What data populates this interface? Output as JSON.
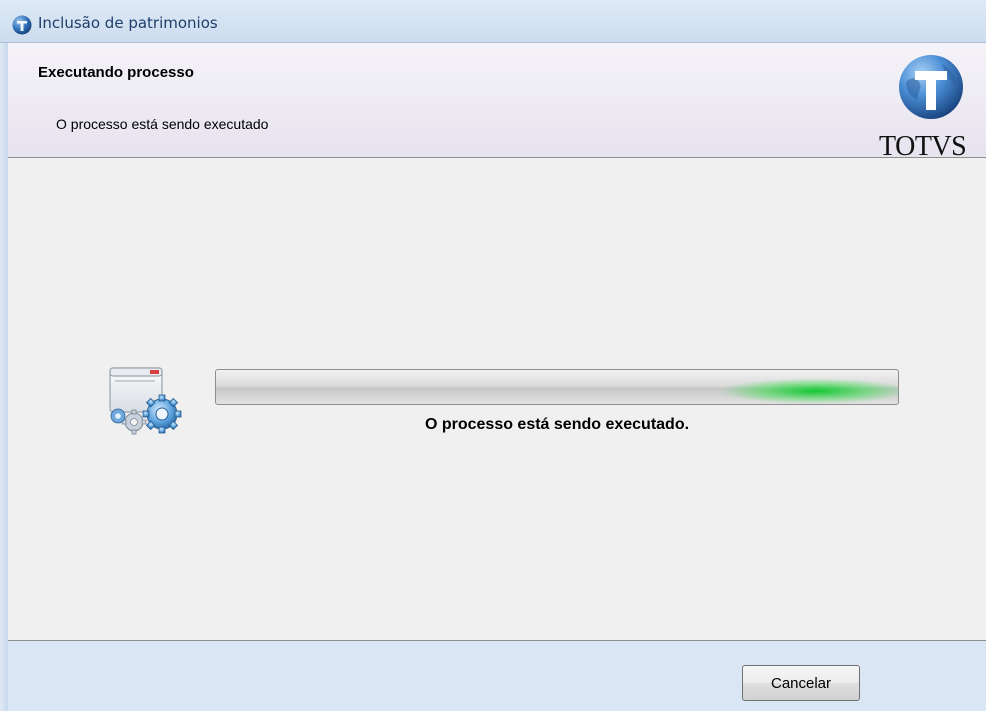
{
  "window": {
    "title": "Inclusão de patrimonios",
    "icon": "totvs-globe-icon"
  },
  "header": {
    "title": "Executando processo",
    "subtitle": "O processo está sendo executado",
    "logo_text": "TOTVS",
    "logo_icon": "totvs-globe-icon"
  },
  "main": {
    "icon": "process-gears-icon",
    "progress": {
      "state": "indeterminate",
      "label": "O processo está sendo executado."
    }
  },
  "footer": {
    "cancel_label": "Cancelar"
  },
  "colors": {
    "accent_green": "#18c832",
    "title_text": "#1e3f6b",
    "footer_bg": "#dbe6f4",
    "header_bg": "#ebe8f1"
  }
}
